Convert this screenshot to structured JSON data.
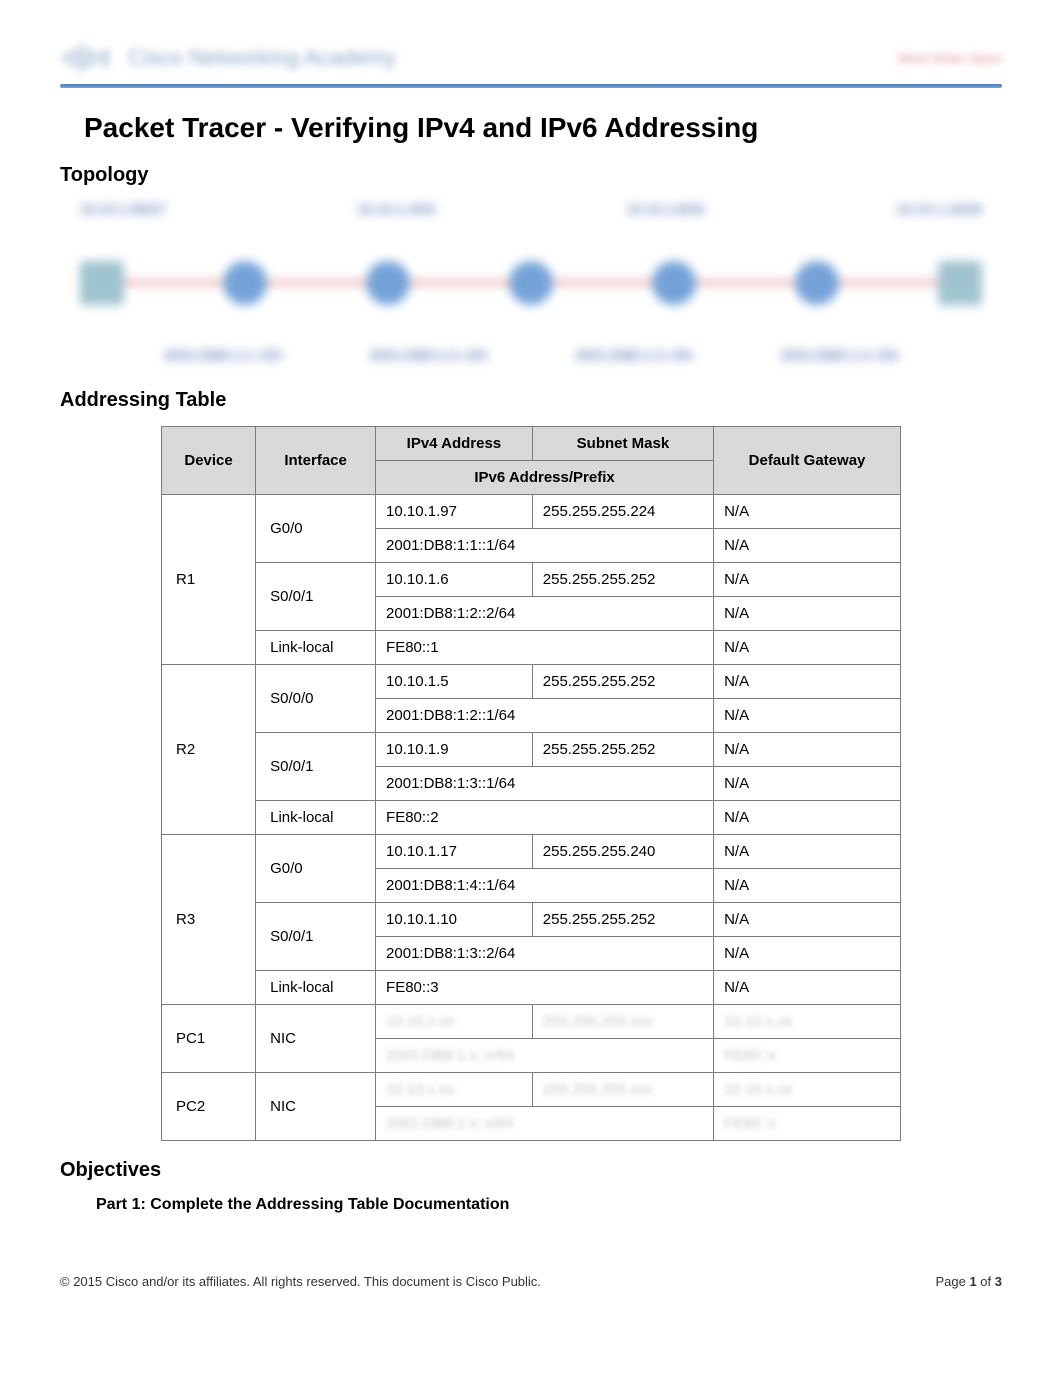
{
  "header": {
    "brand": "Cisco Networking Academy",
    "right": "Mind Wide Open"
  },
  "title": "Packet Tracer - Verifying IPv4 and IPv6 Addressing",
  "sections": {
    "topology": "Topology",
    "addressing": "Addressing Table",
    "objectives": "Objectives"
  },
  "table_headers": {
    "device": "Device",
    "interface": "Interface",
    "ipv4": "IPv4 Address",
    "mask": "Subnet Mask",
    "ipv6": "IPv6 Address/Prefix",
    "gateway": "Default Gateway"
  },
  "rows": [
    {
      "device": "R1",
      "iface": "G0/0",
      "ipv4": "10.10.1.97",
      "mask": "255.255.255.224",
      "ipv6": "2001:DB8:1:1::1/64",
      "gw4": "N/A",
      "gw6": "N/A"
    },
    {
      "device": "R1",
      "iface": "S0/0/1",
      "ipv4": "10.10.1.6",
      "mask": "255.255.255.252",
      "ipv6": "2001:DB8:1:2::2/64",
      "gw4": "N/A",
      "gw6": "N/A"
    },
    {
      "device": "R1",
      "iface": "Link-local",
      "ipv4": "",
      "mask": "",
      "ipv6": "FE80::1",
      "gw4": "",
      "gw6": "N/A",
      "link_only": true
    },
    {
      "device": "R2",
      "iface": "S0/0/0",
      "ipv4": "10.10.1.5",
      "mask": "255.255.255.252",
      "ipv6": "2001:DB8:1:2::1/64",
      "gw4": "N/A",
      "gw6": "N/A"
    },
    {
      "device": "R2",
      "iface": "S0/0/1",
      "ipv4": "10.10.1.9",
      "mask": "255.255.255.252",
      "ipv6": "2001:DB8:1:3::1/64",
      "gw4": "N/A",
      "gw6": "N/A"
    },
    {
      "device": "R2",
      "iface": "Link-local",
      "ipv4": "",
      "mask": "",
      "ipv6": "FE80::2",
      "gw4": "",
      "gw6": "N/A",
      "link_only": true
    },
    {
      "device": "R3",
      "iface": "G0/0",
      "ipv4": "10.10.1.17",
      "mask": "255.255.255.240",
      "ipv6": "2001:DB8:1:4::1/64",
      "gw4": "N/A",
      "gw6": "N/A"
    },
    {
      "device": "R3",
      "iface": "S0/0/1",
      "ipv4": "10.10.1.10",
      "mask": "255.255.255.252",
      "ipv6": "2001:DB8:1:3::2/64",
      "gw4": "N/A",
      "gw6": "N/A"
    },
    {
      "device": "R3",
      "iface": "Link-local",
      "ipv4": "",
      "mask": "",
      "ipv6": "FE80::3",
      "gw4": "",
      "gw6": "N/A",
      "link_only": true
    }
  ],
  "pc_rows": [
    {
      "device": "PC1",
      "iface": "NIC"
    },
    {
      "device": "PC2",
      "iface": "NIC"
    }
  ],
  "objectives": {
    "part1": "Part 1: Complete the Addressing Table Documentation"
  },
  "footer": {
    "left": "© 2015 Cisco and/or its affiliates. All rights reserved. This document is Cisco Public.",
    "right_prefix": "Page ",
    "page": "1",
    "of": " of ",
    "total": "3"
  }
}
